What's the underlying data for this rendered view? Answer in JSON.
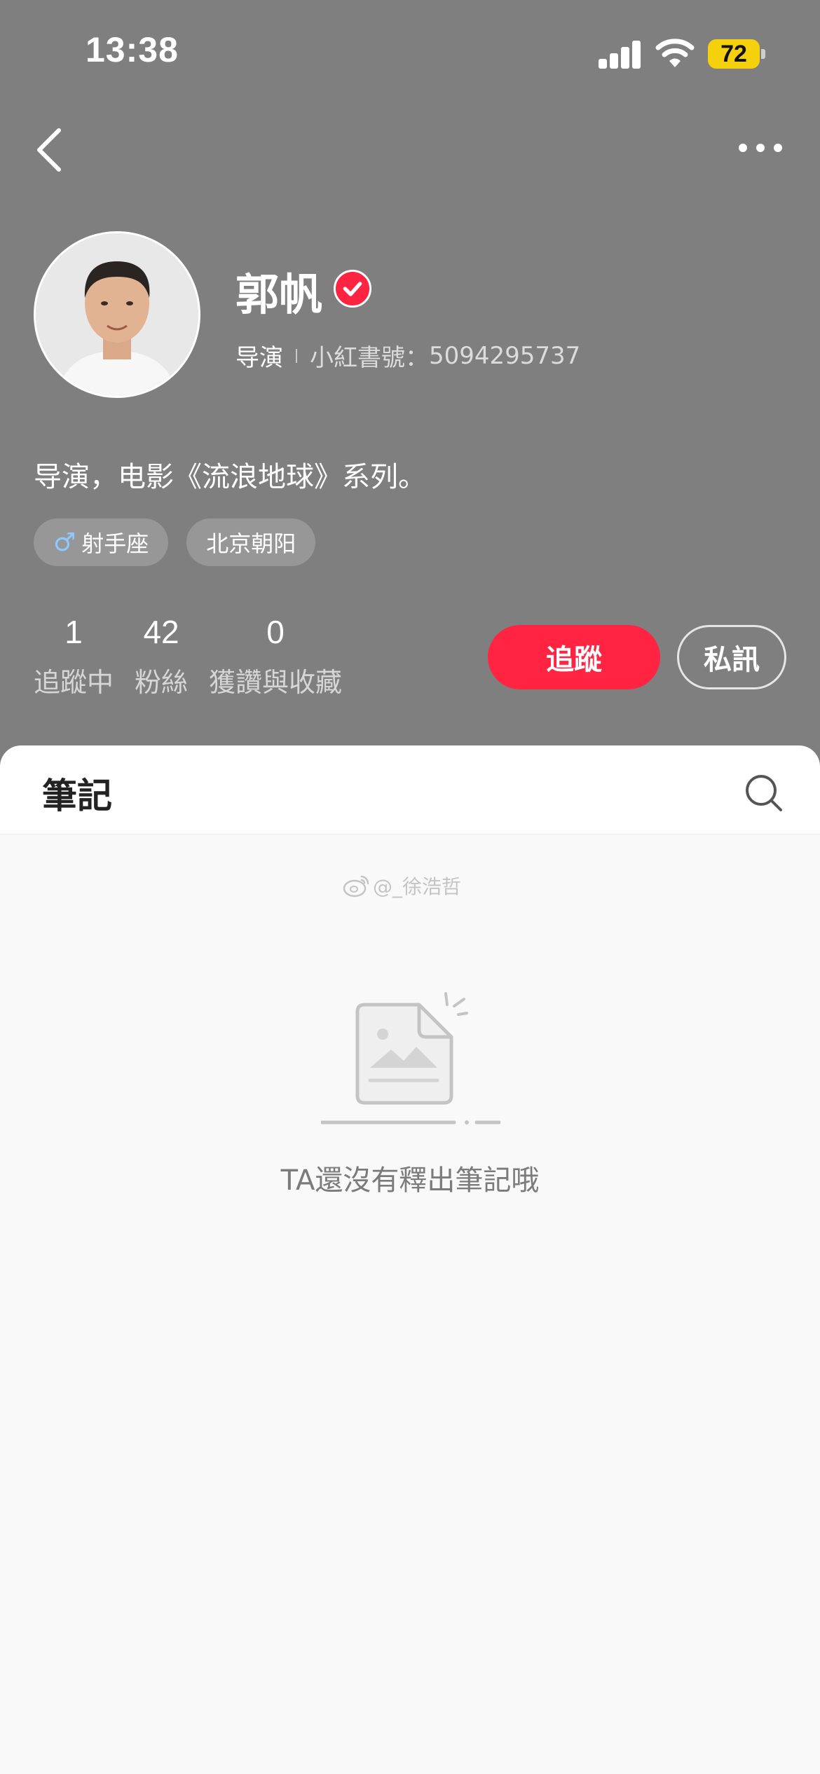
{
  "status_bar": {
    "time": "13:38",
    "battery": "72"
  },
  "profile": {
    "name": "郭帆",
    "role": "导演",
    "id_label": "小紅書號：",
    "id_value": "5094295737",
    "bio": "导演，电影《流浪地球》系列。",
    "tags": [
      {
        "icon": "male-icon",
        "label": "射手座"
      },
      {
        "label": "北京朝阳"
      }
    ],
    "stats": [
      {
        "value": "1",
        "label": "追蹤中"
      },
      {
        "value": "42",
        "label": "粉絲"
      },
      {
        "value": "0",
        "label": "獲讚與收藏"
      }
    ],
    "follow_label": "追蹤",
    "message_label": "私訊"
  },
  "tabs": {
    "notes_label": "筆記"
  },
  "watermark": {
    "text": "@_徐浩哲"
  },
  "empty_state": {
    "text": "TA還沒有釋出筆記哦"
  },
  "colors": {
    "header_bg": "#7f7f7f",
    "accent": "#ff2442",
    "page_bg": "#f9f9f9"
  }
}
